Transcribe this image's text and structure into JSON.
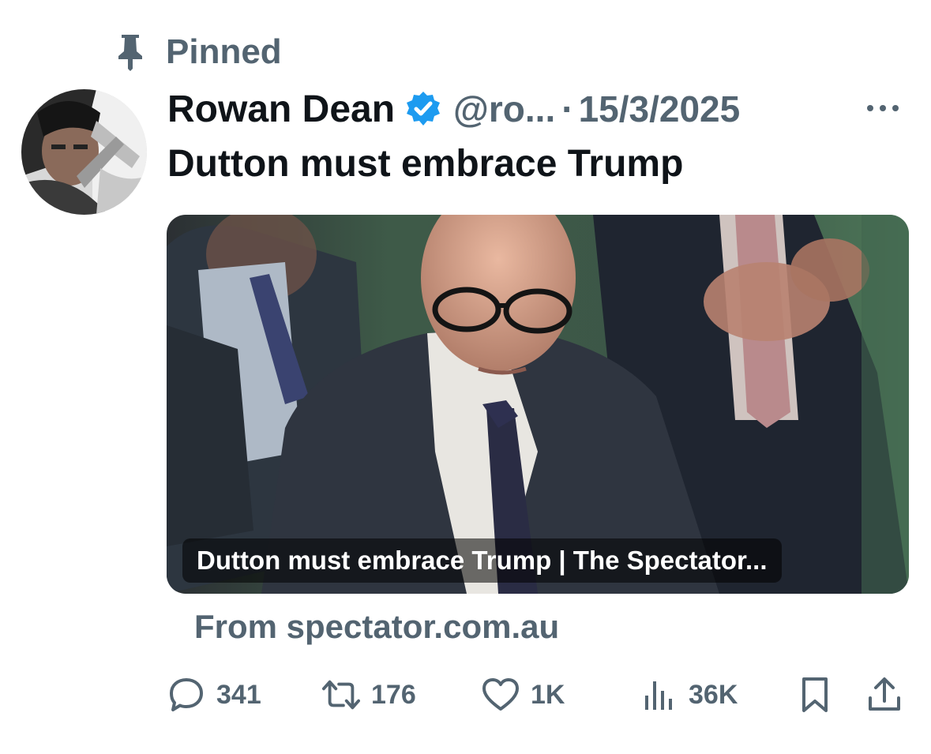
{
  "pinned": {
    "label": "Pinned",
    "icon": "pin-icon"
  },
  "author": {
    "display_name": "Rowan Dean",
    "handle": "@ro...",
    "separator": "·",
    "date": "15/3/2025",
    "verified_icon": "verified-badge-icon",
    "avatar_description": "author-avatar"
  },
  "tweet": {
    "text": "Dutton must embrace Trump"
  },
  "card": {
    "caption": "Dutton must embrace Trump | The Spectator...",
    "source": "From spectator.com.au"
  },
  "actions": {
    "replies": "341",
    "reposts": "176",
    "likes": "1K",
    "views": "36K"
  },
  "colors": {
    "text_primary": "#0f1419",
    "text_secondary": "#536471",
    "verified_blue": "#1d9bf0",
    "background": "#ffffff"
  }
}
